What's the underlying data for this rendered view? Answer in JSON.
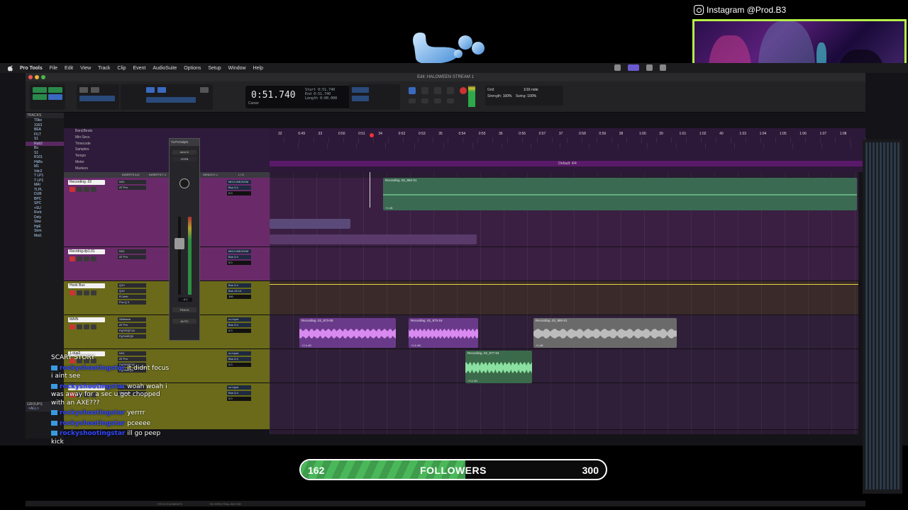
{
  "instagram": {
    "handle": "Instagram @Prod.B3"
  },
  "menubar": {
    "app": "Pro Tools",
    "items": [
      "File",
      "Edit",
      "View",
      "Track",
      "Clip",
      "Event",
      "AudioSuite",
      "Options",
      "Setup",
      "Window",
      "Help"
    ]
  },
  "window": {
    "title": "Edit: HALOWEEN STREAM 1"
  },
  "counter": {
    "main": "0:51.740",
    "start_label": "Start",
    "start": "0:51.740",
    "end_label": "End",
    "end": "0:51.740",
    "length_label": "Length",
    "length": "0:00.000",
    "cursor_label": "Cursor"
  },
  "grid": {
    "grid_label": "Grid",
    "grid_value": "1/16 note",
    "strength_label": "Strength:",
    "strength": "100%",
    "swing_label": "Swing:",
    "swing": "100%"
  },
  "tracks_panel": {
    "header": "TRACKS",
    "items": [
      "T9ko",
      "3163",
      "BEA",
      "FILT",
      "S1",
      "Rub2",
      "Bo",
      "S1",
      "R101",
      "HkBs",
      "M1",
      "Vdc2",
      "T LP1",
      "T LP1",
      "MAI",
      "TLPL",
      "DUB",
      "BPC",
      "SPC",
      "+SU",
      "Rvrb",
      "Dely",
      "Sbw",
      "HpE",
      "Strm",
      "Mai1"
    ],
    "groups_header": "GROUPS",
    "groups_item": "<ALL>"
  },
  "rulers": [
    "Bars|Beats",
    "Min:Secs",
    "Timecode",
    "Samples",
    "Tempo",
    "Meter",
    "Markers"
  ],
  "ruler_bars": [
    "32",
    "0:49",
    "33",
    "0:50",
    "0:51",
    "34",
    "0:52",
    "0:53",
    "35",
    "0:54",
    "0:55",
    "36",
    "0:56",
    "0:57",
    "37",
    "0:58",
    "0:59",
    "38",
    "1:00",
    "39",
    "1:01",
    "1:02",
    "40",
    "1:03",
    "1:04",
    "1:05",
    "1:06",
    "1:07",
    "1:08"
  ],
  "meter_default": "Default: 4/4",
  "mix_headers": [
    "INSERTS A-E",
    "INSERTS F-J",
    "SENDS A-E",
    "SENDS F-J",
    "I / O"
  ],
  "tracks": [
    {
      "name": "Recording .02",
      "inserts": [
        "NS1",
        "AT Pro"
      ],
      "io": [
        "MIC/LINE/HZ/M",
        "Bus 3-4"
      ],
      "vol": "0.0"
    },
    {
      "name": "Recrdng.dp1.01",
      "inserts": [
        "NS1",
        "AT Pro"
      ],
      "io": [
        "MIC/LINE/HZ/M",
        "Bus 3-4"
      ],
      "vol": "0.0"
    },
    {
      "name": "Hook Bus",
      "inserts": [
        "Q10",
        "Q10",
        "R-Verb",
        "Pro-Q 3"
      ],
      "io": [
        "Bus 3-4",
        "Bus 13-14"
      ],
      "vol": "100"
    },
    {
      "name": "MAIN",
      "inserts": [
        "Sibilance",
        "AT Pro",
        "PgTrEQP1A",
        "PgTrMEQ5"
      ],
      "io": [
        "no input",
        "Bus 3-4"
      ],
      "vol": "0.0"
    },
    {
      "name": "1.dup2",
      "inserts": [
        "NS1",
        "AT Pro",
        "PgTrEQP1A",
        "PgTrMEQ5"
      ],
      "io": [
        "no input",
        "Bus 3-4"
      ],
      "vol": "0.0"
    },
    {
      "name": "",
      "inserts": [
        "NS1",
        "Sibilance"
      ],
      "io": [
        "no input",
        "Bus 3-4"
      ],
      "vol": "0.0"
    }
  ],
  "clips": [
    {
      "name": "Recording .02_982-01",
      "gain": "+0 dB"
    },
    {
      "name": "Recording .02_973-05",
      "gain": "+2.6 dB"
    },
    {
      "name": "Recording .02_973-16",
      "gain": "+2.6 dB"
    },
    {
      "name": "Recording .02_980-01",
      "gain": "+0 dB"
    },
    {
      "name": "Recording .02_977-04",
      "gain": "+3.5 dB"
    }
  ],
  "strip": {
    "name": "TLPVOIdpl1",
    "send": "send b",
    "label": "VERB",
    "vol": "-4.1",
    "track_btn": "TRACK",
    "mode": "AUTO"
  },
  "bottom": {
    "items": [
      "PITCH ELEMENTS",
      "RX SPECTRAL EDITOR"
    ]
  },
  "chat": [
    {
      "user": "",
      "text": "SCARY STORY"
    },
    {
      "user": "rockyshootingstar",
      "text": "it didnt focus i aint see"
    },
    {
      "user": "rockyshootingstar",
      "text": "woah woah i was away for a sec u got chopped with an AXE???"
    },
    {
      "user": "rockyshootingstar",
      "text": "yerrrr"
    },
    {
      "user": "rockyshootingstar",
      "text": "pceeee"
    },
    {
      "user": "rockyshootingstar",
      "text": "ill go peep kick"
    }
  ],
  "followers": {
    "current": "162",
    "label": "FOLLOWERS",
    "goal": "300",
    "progress": 0.54
  }
}
